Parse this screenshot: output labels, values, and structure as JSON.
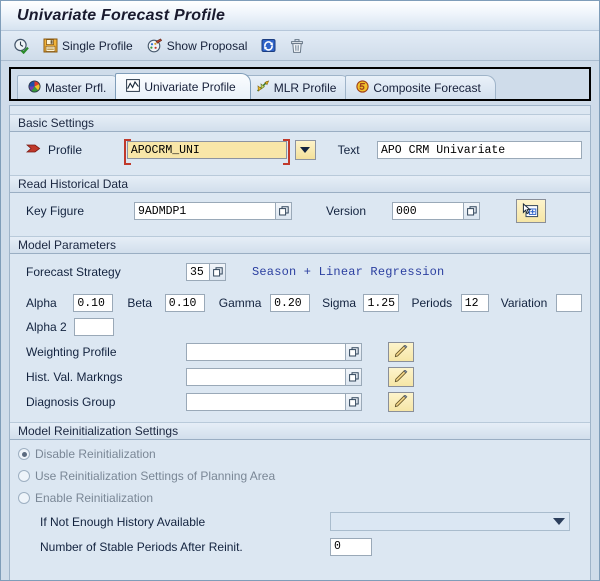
{
  "window": {
    "title": "Univariate Forecast Profile"
  },
  "toolbar": {
    "execute_icon": "execute-clock-icon",
    "single_profile_label": "Single Profile",
    "single_profile_icon": "save-floppy-icon",
    "show_proposal_label": "Show Proposal",
    "show_proposal_icon": "proposal-palette-icon",
    "refresh_icon": "refresh-icon",
    "delete_icon": "trash-icon"
  },
  "tabs": [
    {
      "label": "Master Prfl.",
      "icon": "color-wheel-icon",
      "active": false
    },
    {
      "label": "Univariate Profile",
      "icon": "line-chart-icon",
      "active": true
    },
    {
      "label": "MLR Profile",
      "icon": "regression-icon",
      "active": false
    },
    {
      "label": "Composite Forecast",
      "icon": "composite-circle-icon",
      "active": false
    }
  ],
  "basic_settings": {
    "title": "Basic Settings",
    "profile_label": "Profile",
    "profile_icon": "required-arrow-icon",
    "profile_value": "APOCRM_UNI",
    "profile_dropdown_icon": "chevron-down-icon",
    "text_label": "Text",
    "text_value": "APO CRM Univariate"
  },
  "read_historical_data": {
    "title": "Read Historical Data",
    "key_figure_label": "Key Figure",
    "key_figure_value": "9ADMDP1",
    "version_label": "Version",
    "version_value": "000",
    "extra_button_icon": "select-add-icon",
    "f4_icon": "f4-help-icon"
  },
  "model_parameters": {
    "title": "Model Parameters",
    "forecast_strategy_label": "Forecast Strategy",
    "forecast_strategy_value": "35",
    "forecast_strategy_text": "Season + Linear Regression",
    "params": [
      {
        "label": "Alpha",
        "value": "0.10"
      },
      {
        "label": "Beta",
        "value": "0.10"
      },
      {
        "label": "Gamma",
        "value": "0.20"
      },
      {
        "label": "Sigma",
        "value": "1.25"
      },
      {
        "label": "Periods",
        "value": "12"
      },
      {
        "label": "Variation",
        "value": ""
      }
    ],
    "alpha2_label": "Alpha 2",
    "alpha2_value": "",
    "weighting_profile_label": "Weighting Profile",
    "weighting_profile_value": "",
    "hist_val_markings_label": "Hist. Val. Markngs",
    "hist_val_markings_value": "",
    "diagnosis_group_label": "Diagnosis Group",
    "diagnosis_group_value": "",
    "edit_icon": "pencil-edit-icon"
  },
  "model_reinit": {
    "title": "Model Reinitialization Settings",
    "options": [
      {
        "label": "Disable Reinitialization",
        "selected": true
      },
      {
        "label": "Use Reinitialization Settings of Planning Area",
        "selected": false
      },
      {
        "label": "Enable Reinitialization",
        "selected": false
      }
    ],
    "history_label": "If Not Enough History Available",
    "history_value": "",
    "history_dropdown_icon": "chevron-down-icon",
    "stable_periods_label": "Number of Stable Periods After Reinit.",
    "stable_periods_value": "0"
  },
  "colors": {
    "required_field": "#f8e6a8",
    "required_border": "#c0392b",
    "accent_blue": "#2b3fa0",
    "panel": "#dce7f2"
  }
}
